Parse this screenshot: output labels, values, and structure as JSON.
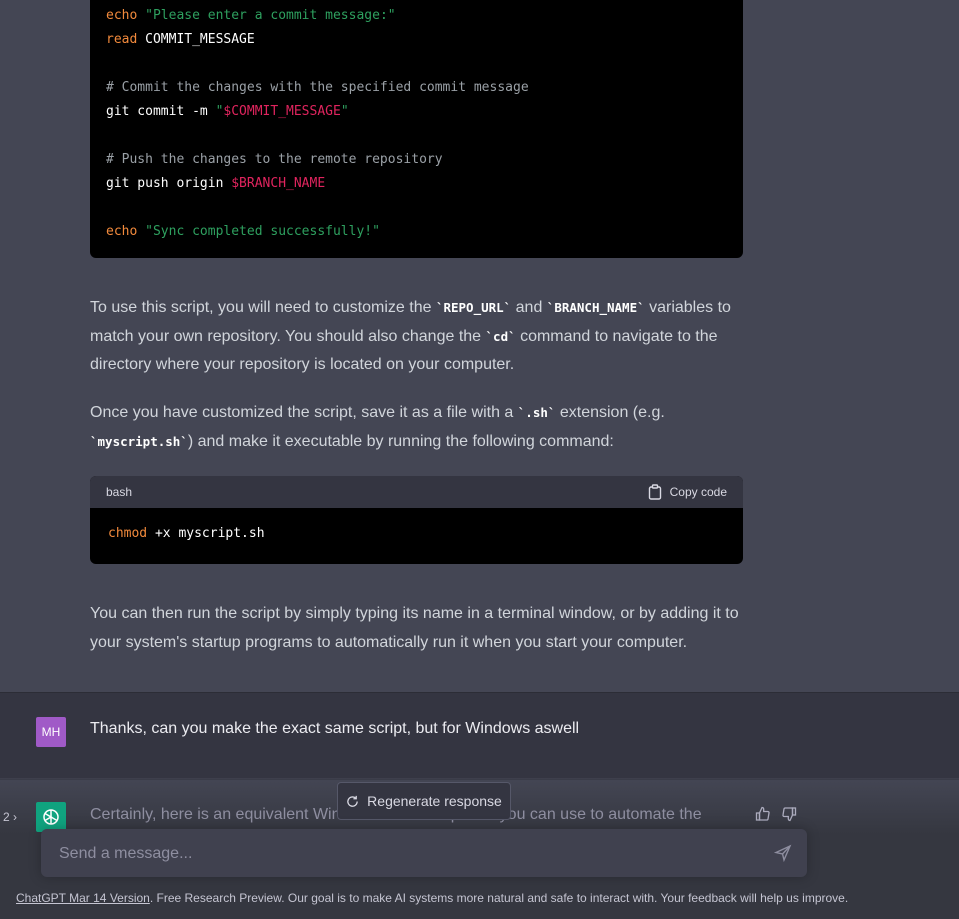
{
  "code1": {
    "lines": [
      [
        {
          "c": "kw",
          "t": "echo"
        },
        {
          "c": "plain",
          "t": " "
        },
        {
          "c": "str",
          "t": "\"Please enter a commit message:\""
        }
      ],
      [
        {
          "c": "kw",
          "t": "read"
        },
        {
          "c": "plain",
          "t": " COMMIT_MESSAGE"
        }
      ],
      [],
      [
        {
          "c": "cmt",
          "t": "# Commit the changes with the specified commit message"
        }
      ],
      [
        {
          "c": "plain",
          "t": "git commit -m "
        },
        {
          "c": "str",
          "t": "\""
        },
        {
          "c": "var",
          "t": "$COMMIT_MESSAGE"
        },
        {
          "c": "str",
          "t": "\""
        }
      ],
      [],
      [
        {
          "c": "cmt",
          "t": "# Push the changes to the remote repository"
        }
      ],
      [
        {
          "c": "plain",
          "t": "git push origin "
        },
        {
          "c": "var",
          "t": "$BRANCH_NAME"
        }
      ],
      [],
      [
        {
          "c": "kw",
          "t": "echo"
        },
        {
          "c": "plain",
          "t": " "
        },
        {
          "c": "str",
          "t": "\"Sync completed successfully!\""
        }
      ]
    ]
  },
  "para1": {
    "p1": "To use this script, you will need to customize the ",
    "c1": "`REPO_URL`",
    "p2": " and ",
    "c2": "`BRANCH_NAME`",
    "p3": " variables to match your own repository. You should also change the ",
    "c3": "`cd`",
    "p4": " command to navigate to the directory where your repository is located on your computer."
  },
  "para2": {
    "p1": "Once you have customized the script, save it as a file with a ",
    "c1": "`.sh`",
    "p2": " extension (e.g. ",
    "c2": "`myscript.sh`",
    "p3": ") and make it executable by running the following command:"
  },
  "code2": {
    "language": "bash",
    "copy_label": "Copy code",
    "cmd": "chmod",
    "args": " +x myscript.sh"
  },
  "para3": "You can then run the script by simply typing its name in a terminal window, or by adding it to your system's startup programs to automatically run it when you start your computer.",
  "user_message": {
    "avatar": "MH",
    "text": "Thanks, can you make the exact same script, but for Windows aswell"
  },
  "assistant_reply": {
    "pager": "2 ›",
    "partial_text": "Certainly, here is an equivalent Windows batch script that you can use to automate the"
  },
  "regenerate_label": "Regenerate response",
  "composer": {
    "placeholder": "Send a message..."
  },
  "footer": {
    "link": "ChatGPT Mar 14 Version",
    "text": ". Free Research Preview. Our goal is to make AI systems more natural and safe to interact with. Your feedback will help us improve."
  },
  "colors": {
    "background": "#444654",
    "user_bg": "#343541",
    "gpt_avatar": "#10a37f",
    "user_avatar": "#a05ac7"
  }
}
